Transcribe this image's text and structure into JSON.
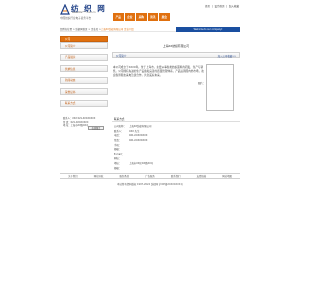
{
  "header": {
    "logo_name": "纺 织 网",
    "logo_url": "www.fzw***.com.cn",
    "slogan": "中国纺织行业电子商务平台",
    "top_links": [
      "首页",
      "|",
      "设为首页",
      "|",
      "加入收藏"
    ],
    "nav": [
      "产品",
      "企业",
      "采购",
      "资讯",
      "展会"
    ]
  },
  "breadcrumb": {
    "path": "您所在位置 > 纺织网首页 > 企业库 > ",
    "current": "上海XX纺织有限公司 企业介绍"
  },
  "welcome": "Welcome to our company!",
  "sidebar": {
    "items": [
      "公司",
      "公司简介",
      "产品展示",
      "供求信息",
      "新闻动态",
      "荣誉证书",
      "联系方式"
    ]
  },
  "contact": {
    "tel_label": "联系人：XXX 021-XXXXXXXX",
    "fax_label": "传 真：021-XXXXXXXX",
    "addr_label": "地 址：上海市XX路XX号",
    "button": "在线留言"
  },
  "main": {
    "company_title": "上海XX纺织有限公司",
    "section_title": "公司简介",
    "more": "加入公司收藏>>",
    "description": "本公司成立于XXXX年，位于上海市，主要从事各类纺织面料的研发、生产与销售。公司拥有先进的生产设备和完善的质量管理体系，产品远销国内外市场，欢迎各界朋友来电洽谈合作，共创美好未来。",
    "photo_label": "图片："
  },
  "info": {
    "heading": "联系方式",
    "rows": [
      {
        "k": "公司名称：",
        "v": "上海XX纺织有限公司"
      },
      {
        "k": "联系人：",
        "v": "XXX 先生"
      },
      {
        "k": "电话：",
        "v": "021-XXXXXXXX"
      },
      {
        "k": "传真：",
        "v": "021-XXXXXXXX"
      },
      {
        "k": "手机：",
        "v": ""
      },
      {
        "k": "邮编：",
        "v": ""
      },
      {
        "k": "E-mail：",
        "v": ""
      },
      {
        "k": "网址：",
        "v": ""
      },
      {
        "k": "地址：",
        "v": "上海市XX区XX路XX号"
      },
      {
        "k": "邮编：",
        "v": ""
      }
    ]
  },
  "footer": {
    "links": [
      "关于我们",
      "网站导航",
      "服务条款",
      "广告服务",
      "联系我们",
      "友情链接",
      "网站地图"
    ],
    "copyright": "本站所有资料版权 1997-2024 纺织网 沪ICP备XXXXXXXX号"
  }
}
